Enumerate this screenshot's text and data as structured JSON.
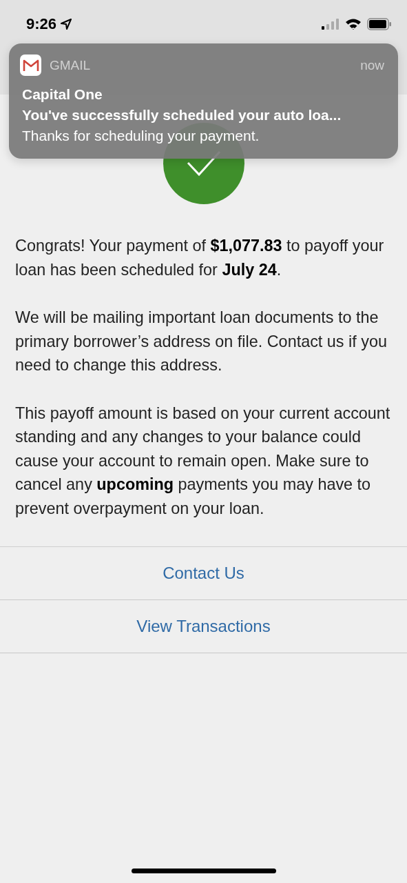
{
  "status_bar": {
    "time": "9:26"
  },
  "notification": {
    "app": "GMAIL",
    "time": "now",
    "sender": "Capital One",
    "subject": "You've successfully scheduled your auto loa...",
    "body": "Thanks for scheduling your payment."
  },
  "message": {
    "paragraphs": [
      "Congrats! Your payment of **$1,077.83** to payoff your loan has been scheduled for **July 24**.",
      "We will be mailing important loan documents to the primary borrower’s address on file. Contact us if you need to change this address.",
      "This payoff amount is based on your current account standing and any changes to your balance could cause your account to remain open. Make sure to cancel any **upcoming** payments you may have to prevent overpayment on your loan."
    ]
  },
  "actions": [
    {
      "label": "Contact Us"
    },
    {
      "label": "View Transactions"
    }
  ]
}
